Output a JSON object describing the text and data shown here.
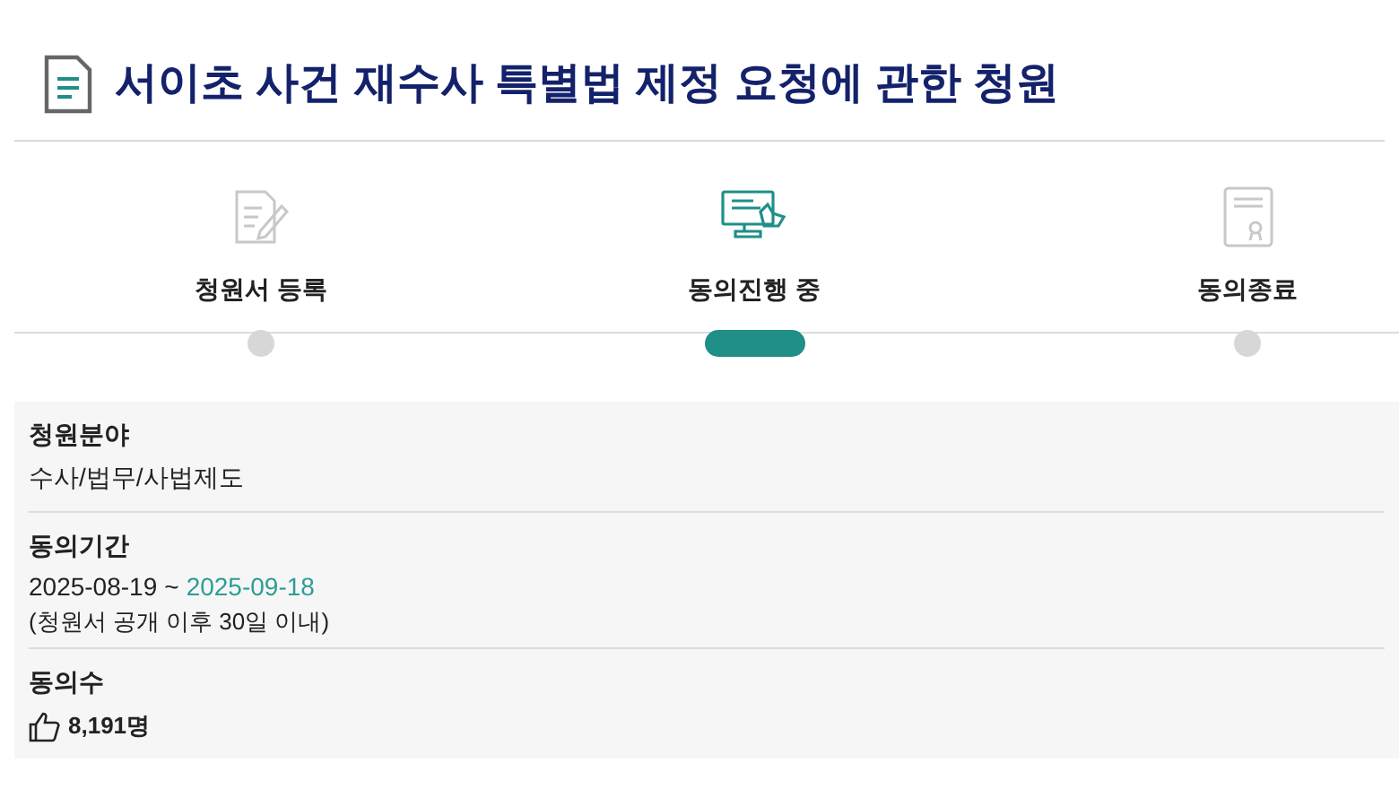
{
  "title": "서이초 사건 재수사 특별법 제정 요청에 관한 청원",
  "steps": [
    {
      "kind": "register",
      "label": "청원서 등록",
      "selected": false
    },
    {
      "kind": "progress",
      "label": "동의진행 중",
      "selected": true
    },
    {
      "kind": "complete",
      "label": "동의종료",
      "selected": false
    }
  ],
  "category": {
    "label": "청원분야",
    "value": "수사/법무/사법제도"
  },
  "period": {
    "label": "동의기간",
    "start": "2025-08-19",
    "separator": "~",
    "end": "2025-09-18",
    "note": "(청원서 공개 이후 30일 이내)"
  },
  "agreements": {
    "label": "동의수",
    "count": "8,191명"
  }
}
